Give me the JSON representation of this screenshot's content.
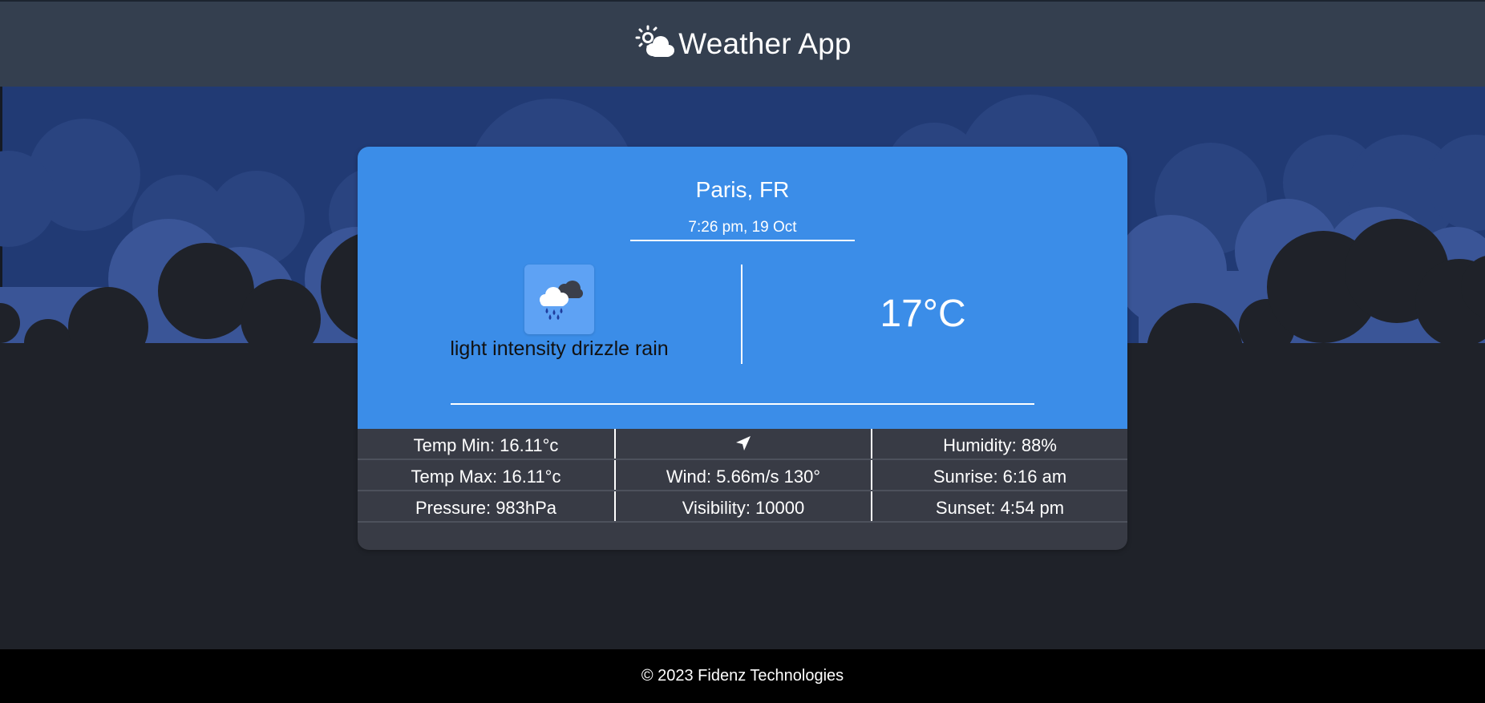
{
  "header": {
    "title": "Weather App",
    "logo_icon": "sun-cloud-icon"
  },
  "weather": {
    "city": "Paris, FR",
    "datetime": "7:26 pm, 19 Oct",
    "condition_icon": "drizzle-rain-icon",
    "description": "light intensity drizzle rain",
    "temperature": "17°C"
  },
  "details": {
    "temp_min": "Temp Min: 16.11°c",
    "temp_max": "Temp Max: 16.11°c",
    "pressure": "Pressure: 983hPa",
    "wind_direction_icon": "navigation-arrow-icon",
    "wind": "Wind: 5.66m/s 130°",
    "visibility": "Visibility: 10000",
    "humidity": "Humidity: 88%",
    "sunrise": "Sunrise: 6:16 am",
    "sunset": "Sunset: 4:54 pm"
  },
  "footer": {
    "copyright": "© 2023 Fidenz Technologies"
  },
  "colors": {
    "header_bg": "#343f4f",
    "sky": "#213a74",
    "card_top": "#3b8de8",
    "card_bottom": "#383b45",
    "footer_bg": "#000000"
  }
}
